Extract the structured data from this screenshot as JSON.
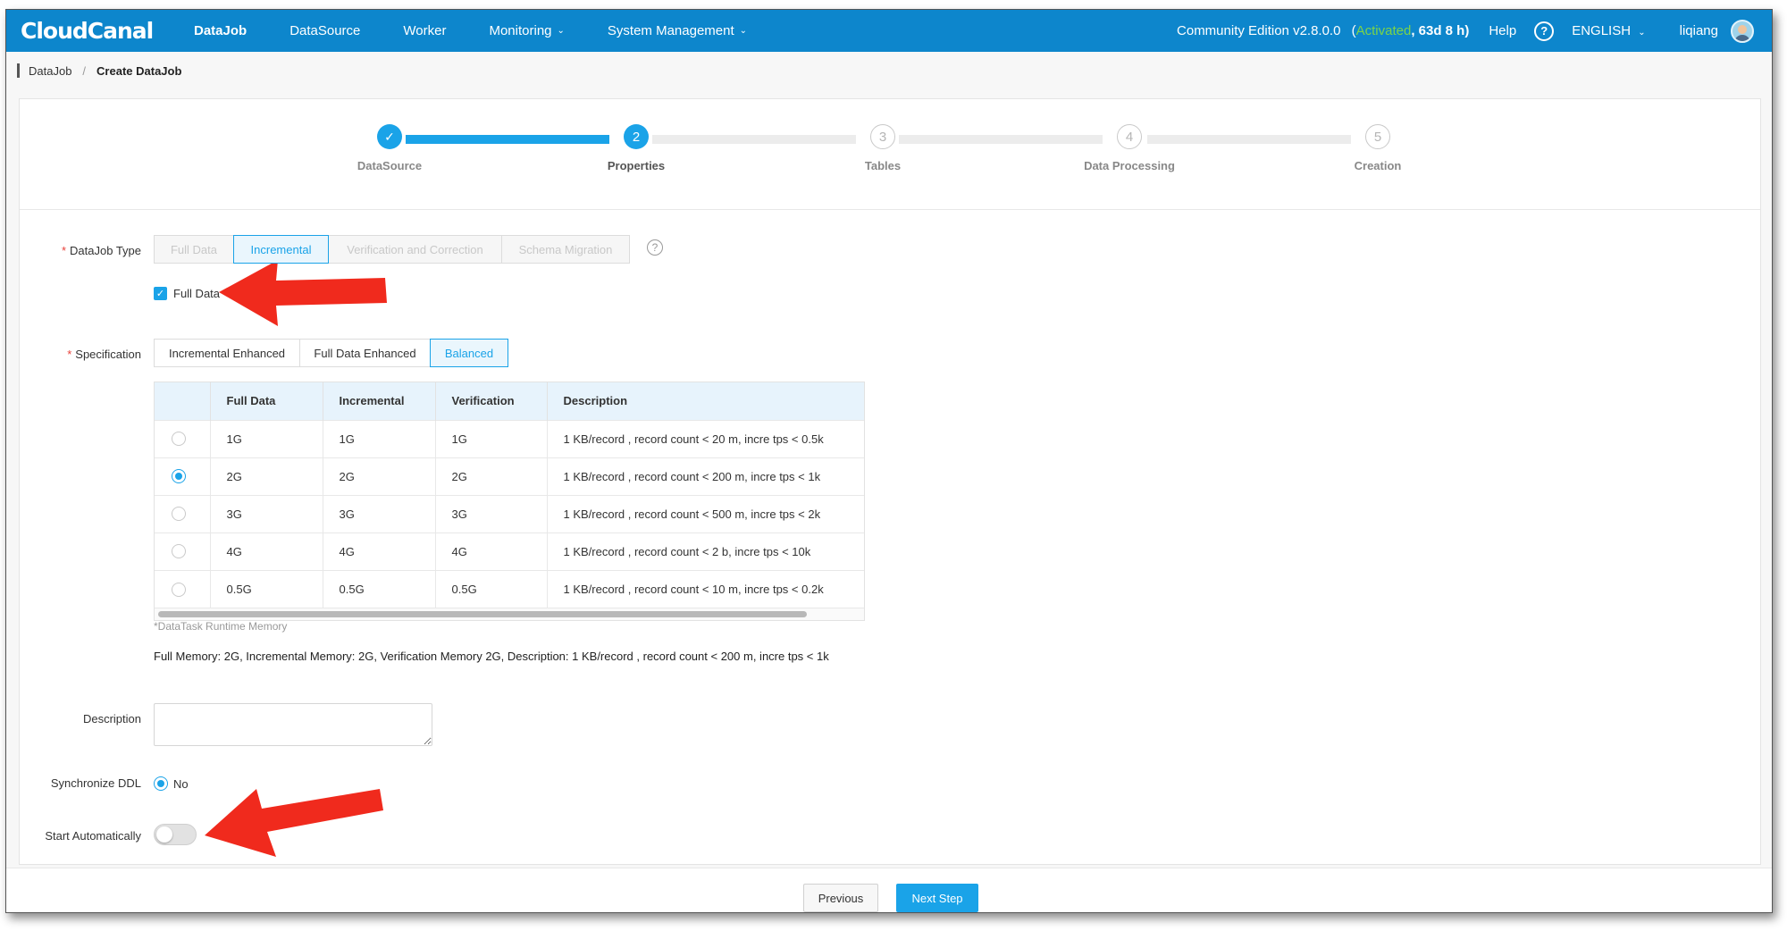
{
  "app": {
    "logo": "CloudCanal"
  },
  "nav": {
    "items": [
      {
        "label": "DataJob",
        "active": true,
        "dropdown": false
      },
      {
        "label": "DataSource",
        "active": false,
        "dropdown": false
      },
      {
        "label": "Worker",
        "active": false,
        "dropdown": false
      },
      {
        "label": "Monitoring",
        "active": false,
        "dropdown": true
      },
      {
        "label": "System Management",
        "active": false,
        "dropdown": true
      }
    ],
    "edition_prefix": "Community Edition v2.8.0.0",
    "activated_open": "(",
    "activated_label": "Activated",
    "activated_days": ", 63d 8 h)",
    "help": "Help",
    "help_icon": "question-circle-icon",
    "language": "ENGLISH",
    "user": "liqiang"
  },
  "breadcrumb": {
    "parent": "DataJob",
    "separator": "/",
    "current": "Create DataJob"
  },
  "steps": [
    {
      "label": "DataSource",
      "number": "",
      "state": "done"
    },
    {
      "label": "Properties",
      "number": "2",
      "state": "current"
    },
    {
      "label": "Tables",
      "number": "3",
      "state": "todo"
    },
    {
      "label": "Data Processing",
      "number": "4",
      "state": "todo"
    },
    {
      "label": "Creation",
      "number": "5",
      "state": "todo"
    }
  ],
  "form": {
    "datajob_type": {
      "label": "DataJob Type",
      "required_mark": "*",
      "options": [
        {
          "label": "Full Data",
          "state": "disabled"
        },
        {
          "label": "Incremental",
          "state": "selected"
        },
        {
          "label": "Verification and Correction",
          "state": "disabled"
        },
        {
          "label": "Schema Migration",
          "state": "disabled"
        }
      ],
      "help_icon": "question-circle-icon"
    },
    "full_data_checkbox": {
      "label": "Full Data",
      "checked": true
    },
    "specification": {
      "label": "Specification",
      "required_mark": "*",
      "options": [
        {
          "label": "Incremental Enhanced",
          "state": "normal"
        },
        {
          "label": "Full Data Enhanced",
          "state": "normal"
        },
        {
          "label": "Balanced",
          "state": "selected"
        }
      ]
    },
    "spec_table": {
      "columns": [
        "",
        "Full Data",
        "Incremental",
        "Verification",
        "Description"
      ],
      "rows": [
        {
          "selected": false,
          "full": "1G",
          "incr": "1G",
          "verify": "1G",
          "desc": "1 KB/record , record count < 20 m, incre tps < 0.5k"
        },
        {
          "selected": true,
          "full": "2G",
          "incr": "2G",
          "verify": "2G",
          "desc": "1 KB/record , record count < 200 m, incre tps < 1k"
        },
        {
          "selected": false,
          "full": "3G",
          "incr": "3G",
          "verify": "3G",
          "desc": "1 KB/record , record count < 500 m, incre tps < 2k"
        },
        {
          "selected": false,
          "full": "4G",
          "incr": "4G",
          "verify": "4G",
          "desc": "1 KB/record , record count < 2 b, incre tps < 10k"
        },
        {
          "selected": false,
          "full": "0.5G",
          "incr": "0.5G",
          "verify": "0.5G",
          "desc": "1 KB/record , record count < 10 m, incre tps < 0.2k"
        }
      ]
    },
    "runtime_note": "*DataTask Runtime Memory",
    "summary": "Full Memory: 2G, Incremental Memory: 2G, Verification Memory 2G, Description: 1 KB/record , record count < 200 m, incre tps < 1k",
    "description": {
      "label": "Description",
      "value": "",
      "placeholder": ""
    },
    "sync_ddl": {
      "label": "Synchronize DDL",
      "option": "No",
      "checked": true
    },
    "start_auto": {
      "label": "Start Automatically",
      "on": false
    }
  },
  "footer": {
    "previous": "Previous",
    "next": "Next Step"
  },
  "colors": {
    "brand": "#0d86cc",
    "accent": "#1aa3e8",
    "activated": "#7cd448",
    "annotation": "#f02a1d"
  }
}
